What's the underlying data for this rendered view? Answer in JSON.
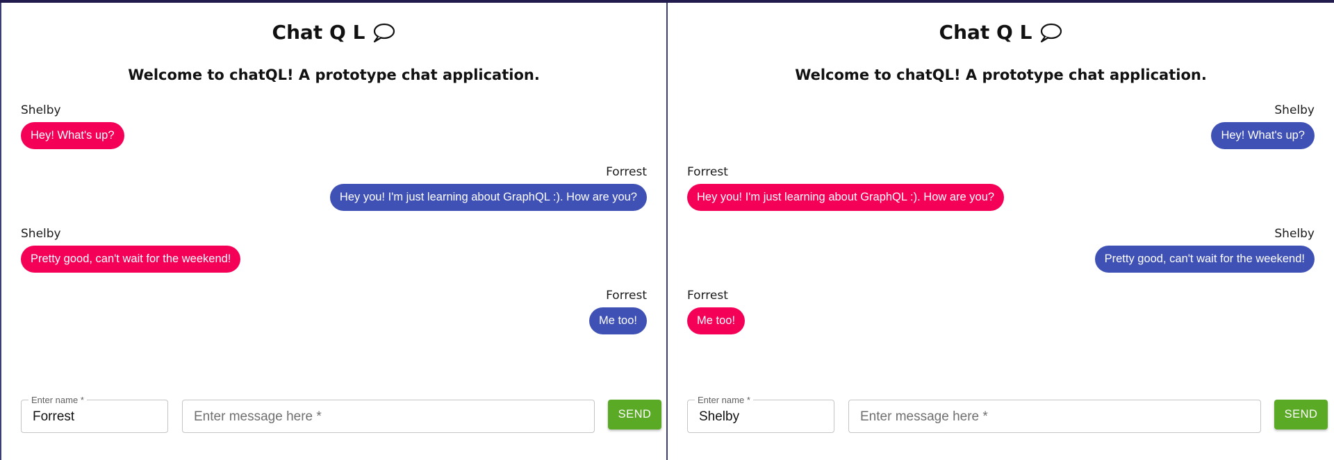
{
  "app": {
    "title": "Chat Q L",
    "subtitle": "Welcome to chatQL! A prototype chat application."
  },
  "panes": [
    {
      "current_user": "Forrest",
      "messages": [
        {
          "sender": "Shelby",
          "text": "Hey! What's up?",
          "side": "theirs"
        },
        {
          "sender": "Forrest",
          "text": "Hey you! I'm just learning about GraphQL :). How are you?",
          "side": "mine"
        },
        {
          "sender": "Shelby",
          "text": "Pretty good, can't wait for the weekend!",
          "side": "theirs"
        },
        {
          "sender": "Forrest",
          "text": "Me too!",
          "side": "mine"
        }
      ],
      "composer": {
        "name_label": "Enter name *",
        "name_value": "Forrest",
        "message_placeholder": "Enter message here *",
        "send_label": "SEND"
      }
    },
    {
      "current_user": "Shelby",
      "messages": [
        {
          "sender": "Shelby",
          "text": "Hey! What's up?",
          "side": "mine"
        },
        {
          "sender": "Forrest",
          "text": "Hey you! I'm just learning about GraphQL :). How are you?",
          "side": "theirs"
        },
        {
          "sender": "Shelby",
          "text": "Pretty good, can't wait for the weekend!",
          "side": "mine"
        },
        {
          "sender": "Forrest",
          "text": "Me too!",
          "side": "theirs"
        }
      ],
      "composer": {
        "name_label": "Enter name *",
        "name_value": "Shelby",
        "message_placeholder": "Enter message here *",
        "send_label": "SEND"
      }
    }
  ],
  "colors": {
    "others_bubble": "#f50057",
    "own_bubble": "#3f51b5",
    "send_button": "#5aaa25",
    "top_border": "#221b4e"
  },
  "icons": {
    "title_icon": "speech-bubble-icon"
  }
}
